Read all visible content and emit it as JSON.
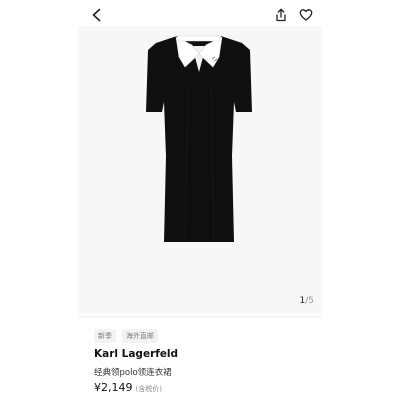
{
  "product": {
    "image_pager": {
      "current": "1",
      "separator": "/",
      "total": "5"
    },
    "tags": [
      "新季",
      "海外直邮"
    ],
    "brand": "Karl Lagerfeld",
    "name": "经典领polo领连衣裙",
    "price": "¥2,149",
    "tax_note": "(含税价)"
  },
  "icons": {
    "back": "chevron-left-icon",
    "share": "share-icon",
    "favorite": "heart-icon"
  },
  "colors": {
    "dress": "#0f0f0f",
    "collar": "#ffffff",
    "background": "#f7f7f7"
  }
}
